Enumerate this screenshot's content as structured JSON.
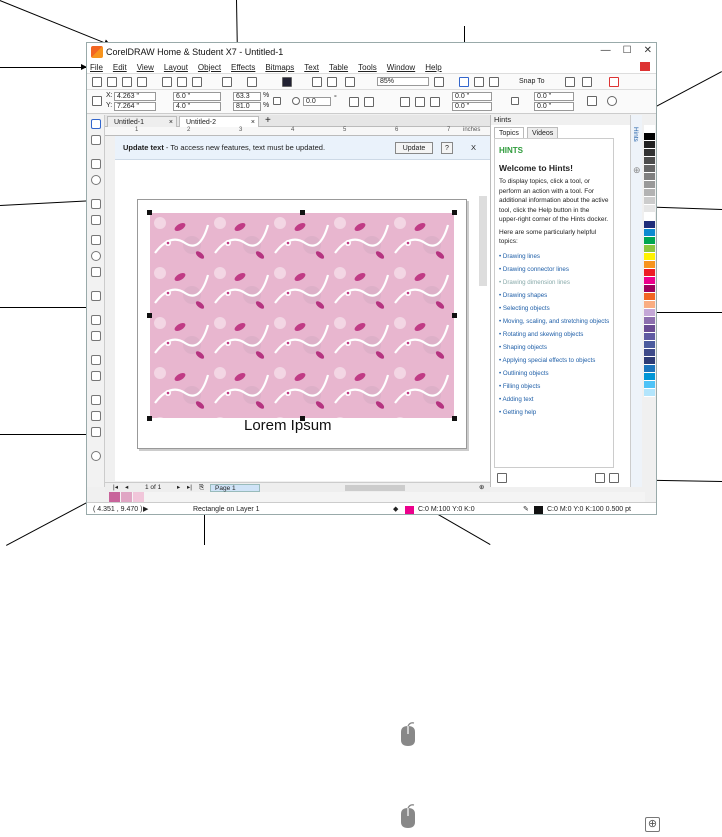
{
  "title": "CorelDRAW Home & Student X7 - Untitled-1",
  "menu": [
    "File",
    "Edit",
    "View",
    "Layout",
    "Object",
    "Effects",
    "Bitmaps",
    "Text",
    "Table",
    "Tools",
    "Window",
    "Help"
  ],
  "toolbar": {
    "zoom": "85%",
    "snap": "Snap To",
    "x": "4.263 \"",
    "y": "7.264 \"",
    "w": "6.0 \"",
    "h": "4.0 \"",
    "sx": "63.3",
    "sy": "81.0",
    "pct": "%",
    "rot": "0.0",
    "deg": "°",
    "o1": "0.0 \"",
    "o2": "0.0 \"",
    "o3": "0.0 \"",
    "o4": "0.0 \""
  },
  "doc_tabs": [
    "Untitled-1",
    "Untitled-2"
  ],
  "ruler_unit": "inches",
  "ruler_ticks": [
    "1",
    "2",
    "3",
    "4",
    "5",
    "6",
    "7"
  ],
  "update_bar": {
    "bold": "Update text",
    "text": " - To access new features, text must be updated.",
    "button": "Update",
    "help": "?",
    "close": "X"
  },
  "canvas_text": "Lorem Ipsum",
  "hints": {
    "panel_title": "Hints",
    "tabs": [
      "Topics",
      "Videos"
    ],
    "brand": "HINTS",
    "welcome": "Welcome to Hints!",
    "intro": "To display topics, click a tool, or perform an action with a tool. For additional information about the active tool, click the Help button in the upper-right corner of the Hints docker.",
    "helpful": "Here are some particularly helpful topics:",
    "links": [
      "• Drawing lines",
      "• Drawing connector lines",
      "• Drawing dimension lines",
      "• Drawing shapes",
      "• Selecting objects",
      "• Moving, scaling, and stretching objects",
      "• Rotating and skewing objects",
      "• Shaping objects",
      "• Applying special effects to objects",
      "• Outlining objects",
      "• Filling objects",
      "• Adding text",
      "• Getting help"
    ],
    "strip_label": "Hints"
  },
  "pager": {
    "of": "1 of 1",
    "page": "Page 1"
  },
  "status": {
    "coords": "( 4.351 , 9.470 )",
    "object": "Rectangle on Layer 1",
    "fill": "C:0 M:100 Y:0 K:0",
    "outline": "C:0 M:0 Y:0 K:100  0.500 pt"
  },
  "palette": [
    "#ffffff",
    "#000000",
    "#222222",
    "#333333",
    "#4d4d4d",
    "#666666",
    "#808080",
    "#999999",
    "#b3b3b3",
    "#cccccc",
    "#e6e6e6",
    "#ffffff",
    "#1f2d7a",
    "#0c8ad0",
    "#00a651",
    "#8dc63f",
    "#fff200",
    "#f7941d",
    "#ed1c24",
    "#ec008c",
    "#9e005d",
    "#f26522",
    "#f9ad81",
    "#c4a7d6",
    "#8d6fae",
    "#6a4c93",
    "#5f5aa2",
    "#4b5b9e",
    "#3e4a89",
    "#2d3b75",
    "#1b75bc",
    "#0096d6",
    "#4fc3f7",
    "#b3e5fc"
  ],
  "doc_palette": [
    "#c8649b",
    "#e0a6c4",
    "#f1c6da"
  ],
  "colors": {
    "accent": "#ec008c",
    "pattern": "#e8b6cf",
    "hints_green": "#2e9b3b"
  }
}
